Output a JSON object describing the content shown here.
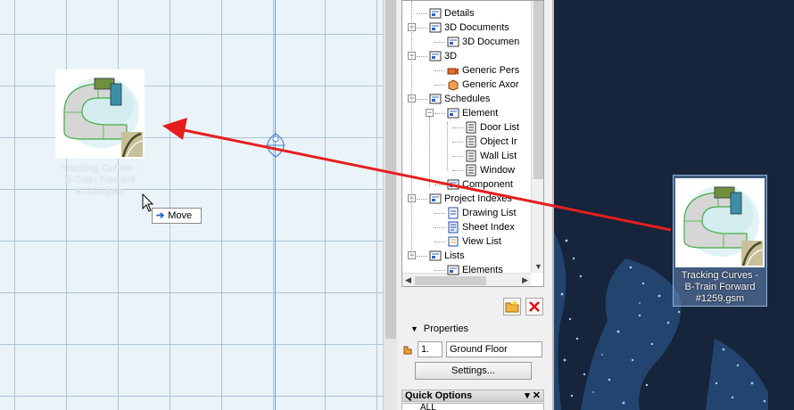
{
  "canvas": {
    "file_caption": [
      "Tracking Curves -",
      "B-Train Forward",
      "#1259.gsm"
    ],
    "tooltip_label": "Move"
  },
  "navigator": {
    "items": [
      {
        "label": "Details",
        "level": 1,
        "icon": "details-folder-icon"
      },
      {
        "label": "3D Documents",
        "level": 1,
        "icon": "3d-documents-folder-icon"
      },
      {
        "label": "3D Documen",
        "level": 2,
        "icon": "3d-document-icon"
      },
      {
        "label": "3D",
        "level": 1,
        "icon": "3d-folder-icon"
      },
      {
        "label": "Generic Pers",
        "level": 2,
        "icon": "perspective-camera-icon"
      },
      {
        "label": "Generic Axor",
        "level": 2,
        "icon": "axonometry-icon"
      },
      {
        "label": "Schedules",
        "level": 1,
        "icon": "schedules-folder-icon"
      },
      {
        "label": "Element",
        "level": 2,
        "icon": "element-schedule-folder-icon"
      },
      {
        "label": "Door List",
        "level": 3,
        "icon": "schedule-list-icon"
      },
      {
        "label": "Object Ir",
        "level": 3,
        "icon": "schedule-list-icon"
      },
      {
        "label": "Wall List",
        "level": 3,
        "icon": "schedule-list-icon"
      },
      {
        "label": "Window",
        "level": 3,
        "icon": "schedule-list-icon"
      },
      {
        "label": "Component",
        "level": 2,
        "icon": "component-schedule-icon"
      },
      {
        "label": "Project Indexes",
        "level": 1,
        "icon": "project-indexes-folder-icon"
      },
      {
        "label": "Drawing List",
        "level": 2,
        "icon": "drawing-list-icon"
      },
      {
        "label": "Sheet Index",
        "level": 2,
        "icon": "sheet-index-icon"
      },
      {
        "label": "View List",
        "level": 2,
        "icon": "view-list-icon"
      },
      {
        "label": "Lists",
        "level": 1,
        "icon": "lists-folder-icon"
      },
      {
        "label": "Elements",
        "level": 2,
        "icon": "elements-list-icon"
      }
    ]
  },
  "properties": {
    "header": "Properties",
    "code": "1.",
    "floor": "Ground Floor",
    "settings_label": "Settings..."
  },
  "quick_options": {
    "header": "Quick Options",
    "row_value": "ALL"
  },
  "desktop": {
    "file_caption": [
      "Tracking Curves -",
      "B-Train Forward",
      "#1259.gsm"
    ]
  },
  "colors": {
    "arrow": "#e61e1e",
    "desktop_bg": "#16243c",
    "canvas_bg": "#eaf3f8",
    "selection": "#8fb0d8"
  }
}
